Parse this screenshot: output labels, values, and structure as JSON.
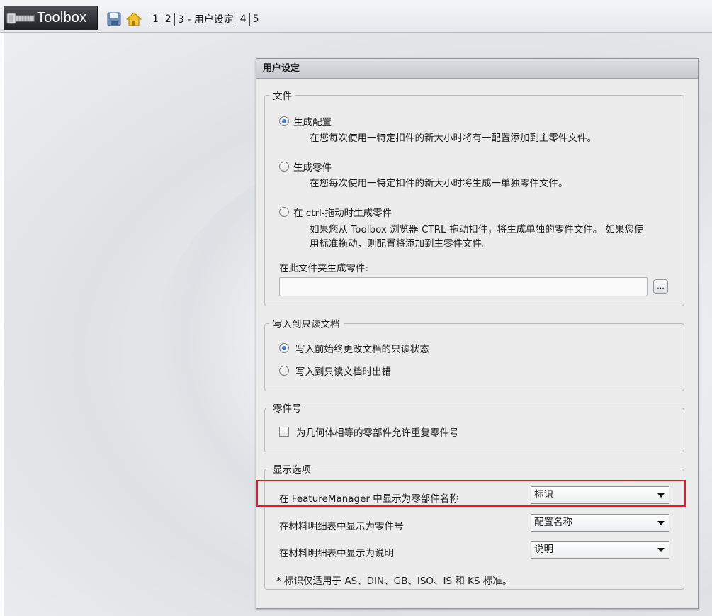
{
  "app": {
    "title": "Toolbox"
  },
  "breadcrumb": [
    "1",
    "2",
    "3 - 用户设定",
    "4",
    "5"
  ],
  "panel": {
    "title": "用户设定",
    "file_group": {
      "legend": "文件",
      "options": [
        {
          "label": "生成配置",
          "desc": "在您每次使用一特定扣件的新大小时将有一配置添加到主零件文件。",
          "checked": true
        },
        {
          "label": "生成零件",
          "desc": "在您每次使用一特定扣件的新大小时将生成一单独零件文件。",
          "checked": false
        },
        {
          "label": "在 ctrl-拖动时生成零件",
          "desc_line1": "如果您从 Toolbox 浏览器 CTRL-拖动扣件，将生成单独的零件文件。 如果您使",
          "desc_line2": "用标准拖动，则配置将添加到主零件文件。",
          "checked": false
        }
      ],
      "folder_label": "在此文件夹生成零件:",
      "folder_value": "",
      "browse_label": "..."
    },
    "readonly_group": {
      "legend": "写入到只读文档",
      "options": [
        {
          "label": "写入前始终更改文档的只读状态",
          "checked": true
        },
        {
          "label": "写入到只读文档时出错",
          "checked": false
        }
      ]
    },
    "partnum_group": {
      "legend": "零件号",
      "checkbox_label": "为几何体相等的零部件允许重复零件号",
      "checked": false
    },
    "display_group": {
      "legend": "显示选项",
      "rows": [
        {
          "label": "在 FeatureManager 中显示为零部件名称",
          "value": "标识"
        },
        {
          "label": "在材料明细表中显示为零件号",
          "value": "配置名称"
        },
        {
          "label": "在材料明细表中显示为说明",
          "value": "说明"
        }
      ],
      "note": "* 标识仅适用于 AS、DIN、GB、ISO、IS 和 KS 标准。"
    }
  },
  "colors": {
    "highlight": "#e02020",
    "panel_bg": "#ececec",
    "radio_dot": "#1a4f96"
  }
}
